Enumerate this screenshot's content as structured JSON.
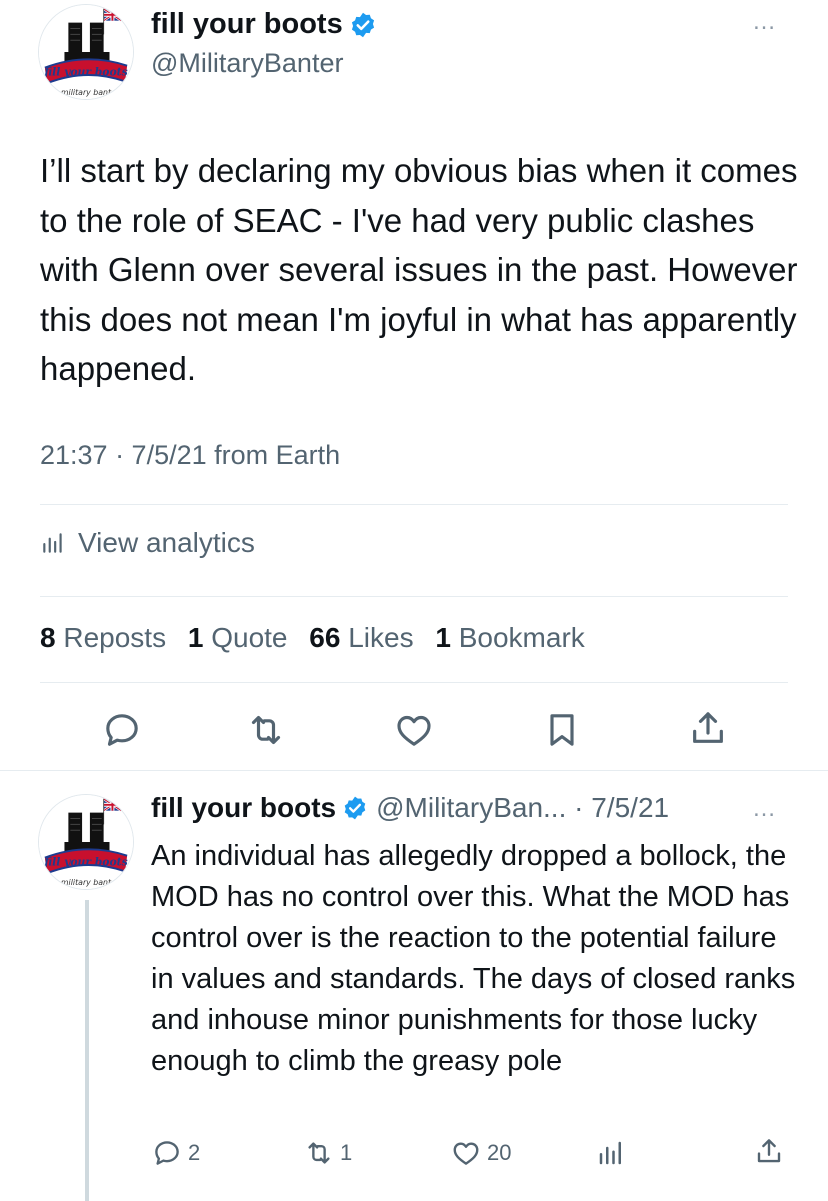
{
  "main_tweet": {
    "author": {
      "display_name": "fill your boots",
      "handle": "@MilitaryBanter",
      "avatar_caption": "military bant"
    },
    "text": "I’ll start by declaring my obvious bias when it comes to the role of SEAC - I've had very public clashes with Glenn over several issues in the past. However this does not mean I'm joyful in what has apparently happened.",
    "meta": "21:37 · 7/5/21 from Earth",
    "analytics_label": "View analytics",
    "stats": {
      "reposts_count": "8",
      "reposts_label": "Reposts",
      "quotes_count": "1",
      "quotes_label": "Quote",
      "likes_count": "66",
      "likes_label": "Likes",
      "bookmarks_count": "1",
      "bookmarks_label": "Bookmark"
    },
    "more_icon": "…",
    "actions": [
      "reply-icon",
      "repost-icon",
      "like-icon",
      "bookmark-icon",
      "share-icon"
    ]
  },
  "reply_tweet": {
    "author": {
      "display_name": "fill your boots",
      "handle_date": "@MilitaryBan... · 7/5/21",
      "avatar_caption": "military bant"
    },
    "text": "An individual has allegedly dropped a bollock, the MOD has no control over this. What the MOD has control over is the reaction to the potential failure in values and standards. The days of closed ranks and inhouse minor punishments for those lucky enough to climb the greasy pole",
    "more_icon": "…",
    "counts": {
      "replies": "2",
      "reposts": "1",
      "likes": "20"
    }
  },
  "colors": {
    "text": "#0f1419",
    "secondary": "#536471",
    "verified": "#1d9bf0",
    "divider": "#e6ecf0"
  }
}
